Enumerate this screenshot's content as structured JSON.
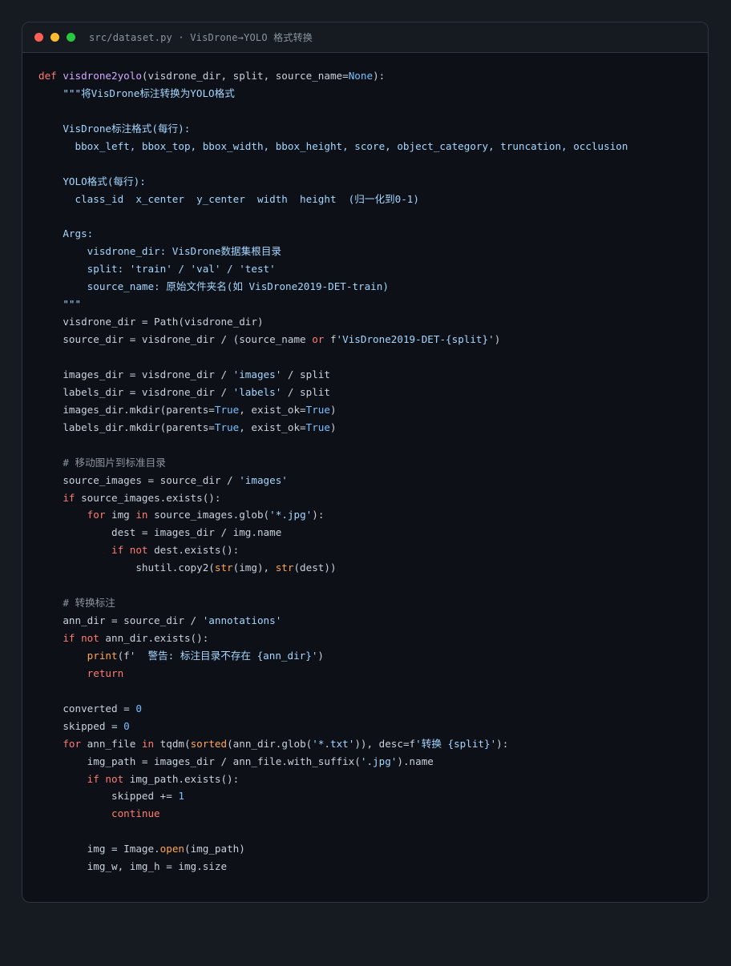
{
  "window": {
    "title": "src/dataset.py · VisDrone→YOLO 格式转换",
    "controls": [
      "close",
      "minimize",
      "maximize"
    ]
  },
  "code": {
    "language": "python",
    "lines": [
      [
        [
          "kw",
          "def "
        ],
        [
          "fn",
          "visdrone2yolo"
        ],
        [
          "op",
          "(visdrone_dir, split, source_name="
        ],
        [
          "const",
          "None"
        ],
        [
          "op",
          "):"
        ]
      ],
      [
        [
          "doc",
          "    \"\"\"将VisDrone标注转换为YOLO格式"
        ]
      ],
      [],
      [
        [
          "doc",
          "    VisDrone标注格式(每行):"
        ]
      ],
      [
        [
          "doc",
          "      bbox_left, bbox_top, bbox_width, bbox_height, score, object_category, truncation, occlusion"
        ]
      ],
      [],
      [
        [
          "doc",
          "    YOLO格式(每行):"
        ]
      ],
      [
        [
          "doc",
          "      class_id  x_center  y_center  width  height  (归一化到0-1)"
        ]
      ],
      [],
      [
        [
          "doc",
          "    Args:"
        ]
      ],
      [
        [
          "doc",
          "        visdrone_dir: VisDrone数据集根目录"
        ]
      ],
      [
        [
          "doc",
          "        split: 'train' / 'val' / 'test'"
        ]
      ],
      [
        [
          "doc",
          "        source_name: 原始文件夹名(如 VisDrone2019-DET-train)"
        ]
      ],
      [
        [
          "doc",
          "    \"\"\""
        ]
      ],
      [
        [
          "op",
          "    visdrone_dir = Path(visdrone_dir)"
        ]
      ],
      [
        [
          "op",
          "    source_dir = visdrone_dir / (source_name "
        ],
        [
          "kw",
          "or"
        ],
        [
          "op",
          " f"
        ],
        [
          "str",
          "'VisDrone2019-DET-{split}'"
        ],
        [
          "op",
          ")"
        ]
      ],
      [],
      [
        [
          "op",
          "    images_dir = visdrone_dir / "
        ],
        [
          "str",
          "'images'"
        ],
        [
          "op",
          " / split"
        ]
      ],
      [
        [
          "op",
          "    labels_dir = visdrone_dir / "
        ],
        [
          "str",
          "'labels'"
        ],
        [
          "op",
          " / split"
        ]
      ],
      [
        [
          "op",
          "    images_dir.mkdir(parents="
        ],
        [
          "const",
          "True"
        ],
        [
          "op",
          ", exist_ok="
        ],
        [
          "const",
          "True"
        ],
        [
          "op",
          ")"
        ]
      ],
      [
        [
          "op",
          "    labels_dir.mkdir(parents="
        ],
        [
          "const",
          "True"
        ],
        [
          "op",
          ", exist_ok="
        ],
        [
          "const",
          "True"
        ],
        [
          "op",
          ")"
        ]
      ],
      [],
      [
        [
          "cm",
          "    # 移动图片到标准目录"
        ]
      ],
      [
        [
          "op",
          "    source_images = source_dir / "
        ],
        [
          "str",
          "'images'"
        ]
      ],
      [
        [
          "kw",
          "    if"
        ],
        [
          "op",
          " source_images.exists():"
        ]
      ],
      [
        [
          "kw",
          "        for"
        ],
        [
          "op",
          " img "
        ],
        [
          "kw",
          "in"
        ],
        [
          "op",
          " source_images.glob("
        ],
        [
          "str",
          "'*.jpg'"
        ],
        [
          "op",
          "):"
        ]
      ],
      [
        [
          "op",
          "            dest = images_dir / img.name"
        ]
      ],
      [
        [
          "kw",
          "            if not"
        ],
        [
          "op",
          " dest.exists():"
        ]
      ],
      [
        [
          "op",
          "                shutil.copy2("
        ],
        [
          "bi",
          "str"
        ],
        [
          "op",
          "(img), "
        ],
        [
          "bi",
          "str"
        ],
        [
          "op",
          "(dest))"
        ]
      ],
      [],
      [
        [
          "cm",
          "    # 转换标注"
        ]
      ],
      [
        [
          "op",
          "    ann_dir = source_dir / "
        ],
        [
          "str",
          "'annotations'"
        ]
      ],
      [
        [
          "kw",
          "    if not"
        ],
        [
          "op",
          " ann_dir.exists():"
        ]
      ],
      [
        [
          "bi",
          "        print"
        ],
        [
          "op",
          "(f"
        ],
        [
          "str",
          "'  警告: 标注目录不存在 {ann_dir}'"
        ],
        [
          "op",
          ")"
        ]
      ],
      [
        [
          "kw",
          "        return"
        ]
      ],
      [],
      [
        [
          "op",
          "    converted = "
        ],
        [
          "const",
          "0"
        ]
      ],
      [
        [
          "op",
          "    skipped = "
        ],
        [
          "const",
          "0"
        ]
      ],
      [
        [
          "kw",
          "    for"
        ],
        [
          "op",
          " ann_file "
        ],
        [
          "kw",
          "in"
        ],
        [
          "op",
          " tqdm("
        ],
        [
          "bi",
          "sorted"
        ],
        [
          "op",
          "(ann_dir.glob("
        ],
        [
          "str",
          "'*.txt'"
        ],
        [
          "op",
          ")), desc=f"
        ],
        [
          "str",
          "'转换 {split}'"
        ],
        [
          "op",
          "):"
        ]
      ],
      [
        [
          "op",
          "        img_path = images_dir / ann_file.with_suffix("
        ],
        [
          "str",
          "'.jpg'"
        ],
        [
          "op",
          ").name"
        ]
      ],
      [
        [
          "kw",
          "        if not"
        ],
        [
          "op",
          " img_path.exists():"
        ]
      ],
      [
        [
          "op",
          "            skipped += "
        ],
        [
          "const",
          "1"
        ]
      ],
      [
        [
          "kw",
          "            continue"
        ]
      ],
      [],
      [
        [
          "op",
          "        img = Image."
        ],
        [
          "bi",
          "open"
        ],
        [
          "op",
          "(img_path)"
        ]
      ],
      [
        [
          "op",
          "        img_w, img_h = img.size"
        ]
      ]
    ]
  }
}
